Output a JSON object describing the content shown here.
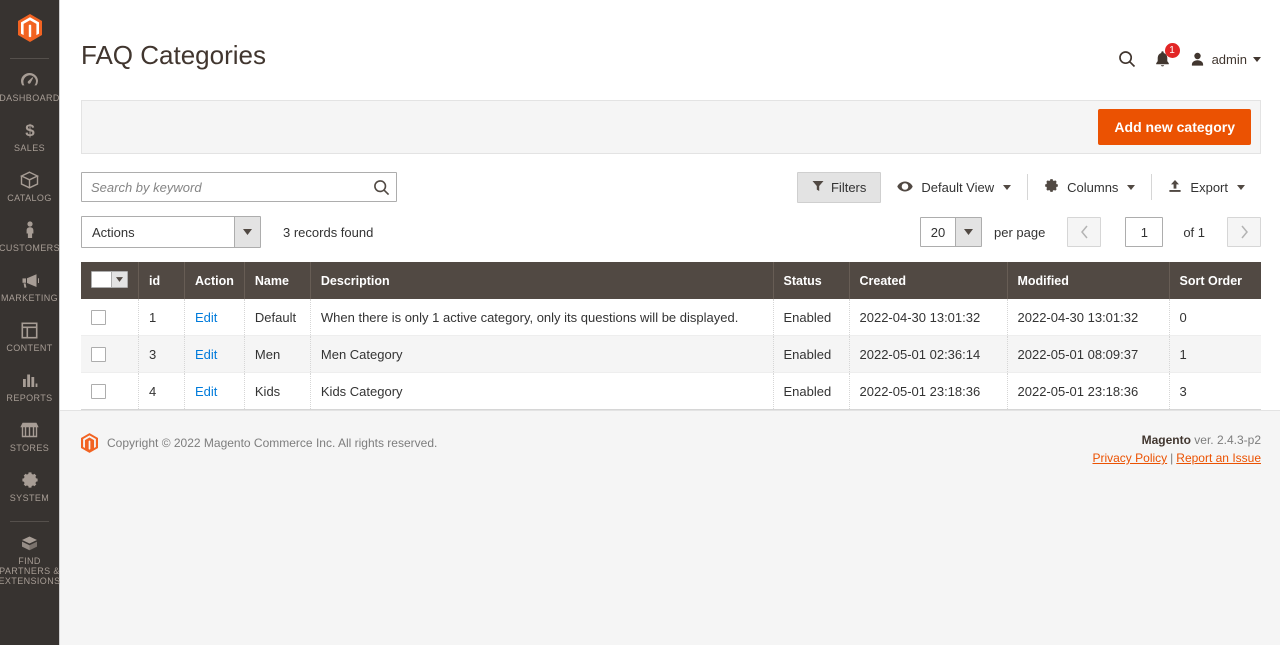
{
  "sidebar": {
    "logo_name": "magento-logo",
    "items": [
      {
        "label": "Dashboard",
        "icon": "dashboard-icon"
      },
      {
        "label": "Sales",
        "icon": "dollar-icon"
      },
      {
        "label": "Catalog",
        "icon": "box-icon"
      },
      {
        "label": "Customers",
        "icon": "person-icon"
      },
      {
        "label": "Marketing",
        "icon": "megaphone-icon"
      },
      {
        "label": "Content",
        "icon": "layout-icon"
      },
      {
        "label": "Reports",
        "icon": "bar-chart-icon"
      },
      {
        "label": "Stores",
        "icon": "storefront-icon"
      },
      {
        "label": "System",
        "icon": "gear-icon"
      },
      {
        "label": "Find Partners\n& Extensions",
        "icon": "package-icon"
      }
    ]
  },
  "header": {
    "title": "FAQ Categories",
    "search_icon": "search-icon",
    "notifications_icon": "bell-icon",
    "notifications_count": "1",
    "user_icon": "user-avatar-icon",
    "user_name": "admin"
  },
  "page_actions": {
    "add_label": "Add new category"
  },
  "toolbar": {
    "search_placeholder": "Search by keyword",
    "search_value": "",
    "search_icon": "search-icon",
    "filters_label": "Filters",
    "filters_icon": "funnel-icon",
    "view_label": "Default View",
    "view_icon": "eye-icon",
    "columns_label": "Columns",
    "columns_icon": "gear-icon",
    "export_label": "Export",
    "export_icon": "upload-icon"
  },
  "actions_bar": {
    "actions_label": "Actions",
    "records_found": "3 records found",
    "per_page_value": "20",
    "per_page_label": "per page",
    "page_value": "1",
    "page_of": "of 1",
    "prev_icon": "chevron-left-icon",
    "next_icon": "chevron-right-icon"
  },
  "grid": {
    "columns": [
      "id",
      "Action",
      "Name",
      "Description",
      "Status",
      "Created",
      "Modified",
      "Sort Order"
    ],
    "edit_label": "Edit",
    "rows": [
      {
        "id": "1",
        "action": "Edit",
        "name": "Default",
        "description": "When there is only 1 active category, only its questions will be displayed.",
        "status": "Enabled",
        "created": "2022-04-30 13:01:32",
        "modified": "2022-04-30 13:01:32",
        "sort_order": "0"
      },
      {
        "id": "3",
        "action": "Edit",
        "name": "Men",
        "description": "Men Category",
        "status": "Enabled",
        "created": "2022-05-01 02:36:14",
        "modified": "2022-05-01 08:09:37",
        "sort_order": "1"
      },
      {
        "id": "4",
        "action": "Edit",
        "name": "Kids",
        "description": "Kids Category",
        "status": "Enabled",
        "created": "2022-05-01 23:18:36",
        "modified": "2022-05-01 23:18:36",
        "sort_order": "3"
      }
    ]
  },
  "footer": {
    "copyright": "Copyright © 2022 Magento Commerce Inc. All rights reserved.",
    "version_brand": "Magento",
    "version_text": " ver. 2.4.3-p2",
    "privacy_policy": "Privacy Policy",
    "link_divider": "|",
    "report_issue": "Report an Issue"
  },
  "colors": {
    "accent_orange": "#eb5202",
    "sidebar_bg": "#373330",
    "table_header_bg": "#514943",
    "link_blue": "#007bdb",
    "badge_red": "#e22626"
  }
}
